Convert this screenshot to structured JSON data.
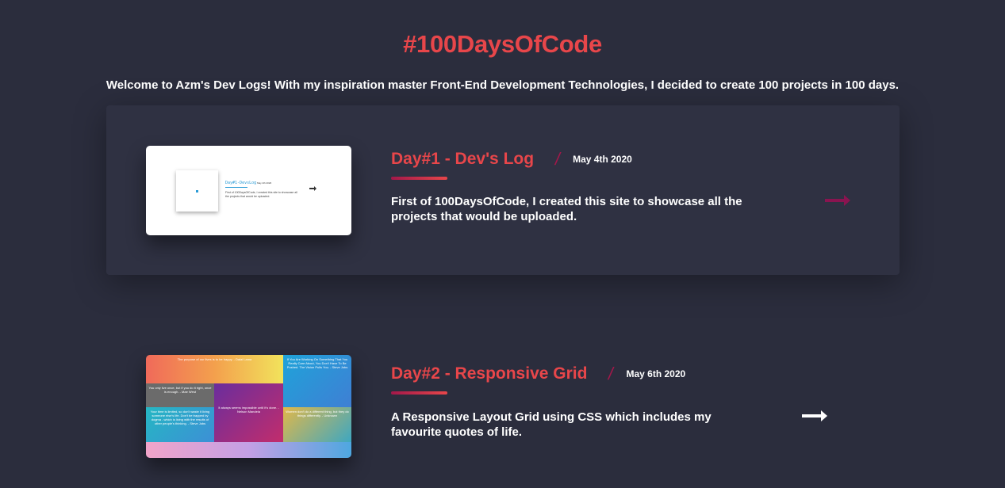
{
  "header": {
    "title": "#100DaysOfCode",
    "intro": "Welcome to Azm's Dev Logs! With my inspiration master Front-End Development Technologies, I decided to create 100 projects in 100 days."
  },
  "logs": [
    {
      "title": "Day#1 - Dev's Log",
      "date": "May 4th 2020",
      "description": "First of 100DaysOfCode, I created this site to showcase all the projects that would be uploaded.",
      "thumbnail": {
        "title": "Day#1-DevsLog",
        "date": "May 4th 2020",
        "description": "First of 100DaysOfCode, I created this site to showcase all the projects that would be uploaded."
      },
      "arrow_color": "#8a1450"
    },
    {
      "title": "Day#2 - Responsive Grid",
      "date": "May 6th 2020",
      "description": "A Responsive Layout Grid using CSS which includes my favourite quotes of life.",
      "thumbnail": {
        "quotes": [
          "The purpose of our lives is to be happy. - Dalai Lama",
          "If You Are Working On Something That You Really Care About, You Don't Have To Be Pushed. The Vision Pulls You. - Steve Jobs",
          "You only live once, but if you do it right, once is enough. - Mae West",
          "It always seems impossible until it's done. - Nelson Mandela",
          "Your time is limited, so don't waste it living someone else's life. Don't be trapped by dogma - which is living with the results of other people's thinking. - Steve Jobs",
          "Women don't do a different thing, but they do things differently. - Unknown"
        ]
      },
      "arrow_color": "#ffffff"
    }
  ],
  "colors": {
    "background": "#2b2d3d",
    "accent": "#e8464a",
    "accent_dark": "#a3184a"
  }
}
